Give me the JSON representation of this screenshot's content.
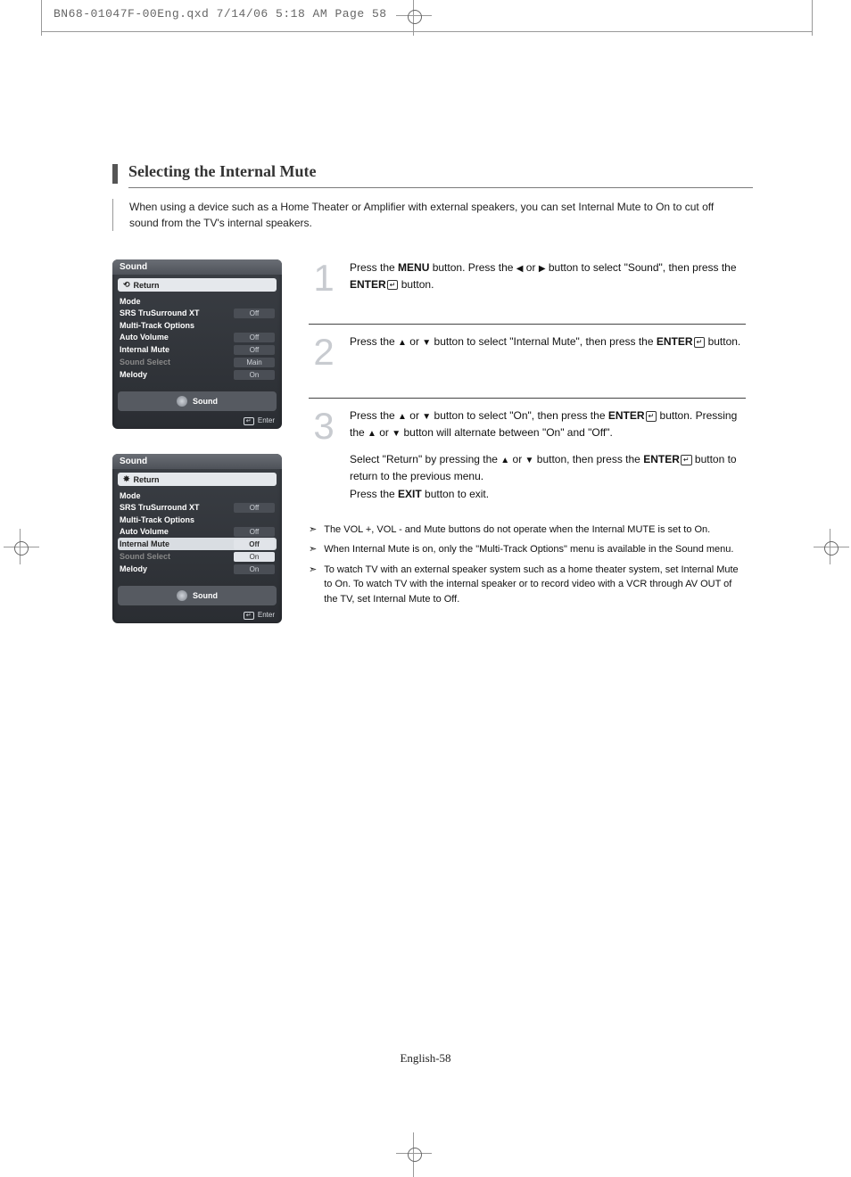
{
  "header": "BN68-01047F-00Eng.qxd  7/14/06  5:18 AM  Page 58",
  "section_title": "Selecting the Internal Mute",
  "intro": "When using a device such as a Home Theater or Amplifier with external speakers, you can set Internal Mute to On to cut off sound from the TV's internal speakers.",
  "page_footer": "English-58",
  "osd1": {
    "title": "Sound",
    "return": "Return",
    "rows": [
      {
        "label": "Mode",
        "val": ""
      },
      {
        "label": "SRS TruSurround XT",
        "val": "Off"
      },
      {
        "label": "Multi-Track Options",
        "val": ""
      },
      {
        "label": "Auto Volume",
        "val": "Off"
      },
      {
        "label": "Internal Mute",
        "val": "Off"
      },
      {
        "label": "Sound Select",
        "val": "Main",
        "dim": true
      },
      {
        "label": "Melody",
        "val": "On"
      }
    ],
    "sound_label": "Sound",
    "enter": "Enter"
  },
  "osd2": {
    "title": "Sound",
    "return": "Return",
    "rows": [
      {
        "label": "Mode",
        "val": ""
      },
      {
        "label": "SRS TruSurround XT",
        "val": "Off"
      },
      {
        "label": "Multi-Track Options",
        "val": ""
      },
      {
        "label": "Auto Volume",
        "val": "Off"
      },
      {
        "label": "Internal Mute",
        "val": "Off",
        "selected": true,
        "light": true
      },
      {
        "label": "Sound Select",
        "val": "On",
        "dim": true,
        "light": true
      },
      {
        "label": "Melody",
        "val": "On"
      }
    ],
    "sound_label": "Sound",
    "enter": "Enter"
  },
  "steps": {
    "s1": {
      "num": "1",
      "text_a": "Press the ",
      "menu": "MENU",
      "text_b": " button. Press the ",
      "text_c": " or ",
      "text_d": " button to select \"Sound\", then press the ",
      "enter": "ENTER",
      "text_e": " button."
    },
    "s2": {
      "num": "2",
      "text_a": "Press the ",
      "text_b": " or ",
      "text_c": " button to select \"Internal Mute\", then press the ",
      "enter": "ENTER",
      "text_d": " button."
    },
    "s3": {
      "num": "3",
      "p1_a": "Press the ",
      "p1_b": " or ",
      "p1_c": " button to select \"On\", then press the ",
      "enter": "ENTER",
      "p1_d": " button. Pressing the ",
      "p1_e": " or ",
      "p1_f": " button will alternate between \"On\" and \"Off\".",
      "p2_a": "Select \"Return\" by pressing the ",
      "p2_b": " or ",
      "p2_c": " button, then press the ",
      "enter2": "ENTER",
      "p2_d": " button to return to the previous menu.",
      "p3_a": "Press the ",
      "exit": "EXIT",
      "p3_b": " button to exit."
    }
  },
  "notes": [
    "The VOL +, VOL - and Mute buttons do not operate when the Internal MUTE is set to On.",
    "When Internal Mute is on, only the \"Multi-Track Options\" menu is available in the Sound menu.",
    "To watch TV with an external speaker system such as a home theater system, set Internal Mute to On. To watch TV with the internal speaker or to record video with a VCR through AV OUT of the TV, set Internal Mute to Off."
  ]
}
